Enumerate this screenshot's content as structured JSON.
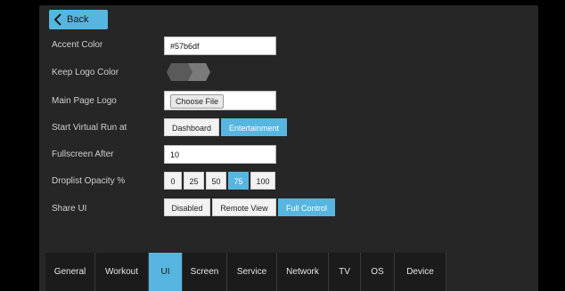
{
  "back_label": "Back",
  "accent": "#57b6df",
  "settings": {
    "accent_color": {
      "label": "Accent Color",
      "value": "#57b6df"
    },
    "keep_logo_color": {
      "label": "Keep Logo Color"
    },
    "main_page_logo": {
      "label": "Main Page Logo",
      "button": "Choose File"
    },
    "start_virtual_run": {
      "label": "Start Virtual Run at",
      "options": [
        "Dashboard",
        "Entertainment"
      ],
      "selected": "Entertainment"
    },
    "fullscreen_after": {
      "label": "Fullscreen After",
      "value": "10"
    },
    "droplist_opacity": {
      "label": "Droplist Opacity %",
      "options": [
        "0",
        "25",
        "50",
        "75",
        "100"
      ],
      "selected": "75"
    },
    "share_ui": {
      "label": "Share UI",
      "options": [
        "Disabled",
        "Remote View",
        "Full Control"
      ],
      "selected": "Full Control"
    }
  },
  "tabs": [
    "General",
    "Workout",
    "UI",
    "Screen",
    "Service",
    "Network",
    "TV",
    "OS",
    "Device"
  ],
  "active_tab": "UI"
}
